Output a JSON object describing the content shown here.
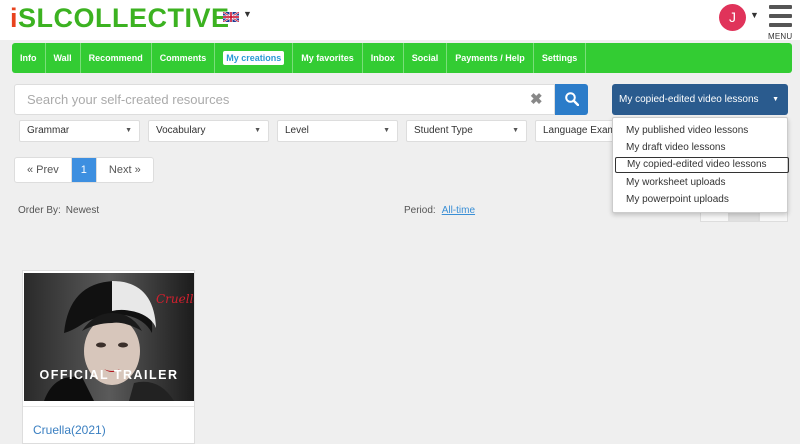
{
  "header": {
    "logo_first": "i",
    "logo_rest": "SLCOLLECTIVE",
    "avatar_initial": "J",
    "menu_label": "MENU"
  },
  "nav": {
    "items": [
      "Info",
      "Wall",
      "Recommend",
      "Comments",
      "My creations",
      "My favorites",
      "Inbox",
      "Social",
      "Payments / Help",
      "Settings"
    ],
    "active": "My creations"
  },
  "search": {
    "placeholder": "Search your self-created resources",
    "value": ""
  },
  "resource_dropdown": {
    "selected": "My copied-edited video lessons",
    "options": [
      "My published video lessons",
      "My draft video lessons",
      "My copied-edited video lessons",
      "My worksheet uploads",
      "My powerpoint uploads"
    ]
  },
  "filters": [
    "Grammar",
    "Vocabulary",
    "Level",
    "Student Type",
    "Language Exam"
  ],
  "pagination": {
    "prev": "« Prev",
    "current": "1",
    "next": "Next »"
  },
  "order": {
    "label": "Order By:",
    "value": "Newest"
  },
  "period": {
    "label": "Period:",
    "value": "All-time"
  },
  "cards": [
    {
      "title": "Cruella(2021)",
      "thumb_brand": "Cruella",
      "thumb_caption": "OFFICIAL TRAILER"
    }
  ],
  "colors": {
    "nav_green": "#33cc33",
    "dropdown_blue": "#2a5b8e",
    "search_blue": "#2b7cc9",
    "active_page": "#3d8fe0",
    "logo_red": "#e8431e",
    "logo_green": "#3cb221",
    "avatar": "#e0335a"
  }
}
